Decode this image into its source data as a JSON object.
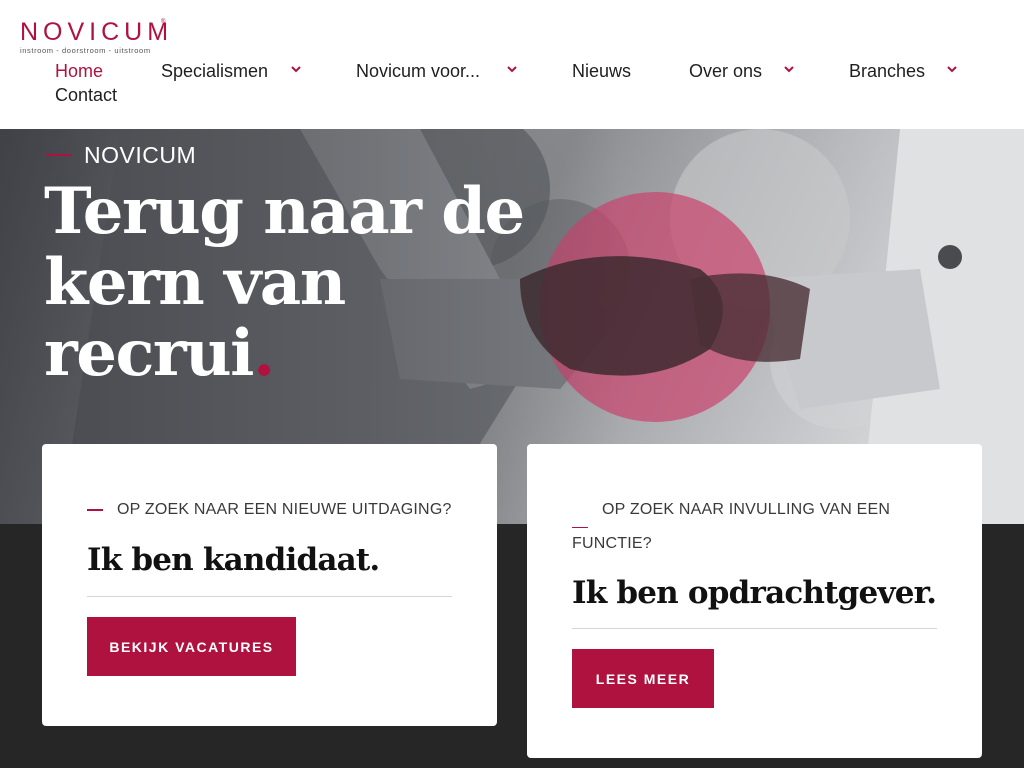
{
  "brand": {
    "name": "NOVICUM",
    "registered_mark": "®",
    "tagline": "instroom - doorstroom - uitstroom",
    "accent_color": "#b0123f"
  },
  "nav": {
    "items": [
      {
        "label": "Home",
        "active": true,
        "has_dropdown": false
      },
      {
        "label": "Specialismen",
        "active": false,
        "has_dropdown": true
      },
      {
        "label": "Novicum voor...",
        "active": false,
        "has_dropdown": true
      },
      {
        "label": "Nieuws",
        "active": false,
        "has_dropdown": false
      },
      {
        "label": "Over ons",
        "active": false,
        "has_dropdown": true
      },
      {
        "label": "Branches",
        "active": false,
        "has_dropdown": true
      },
      {
        "label": "Contact",
        "active": false,
        "has_dropdown": false
      }
    ],
    "dropdown_icon": "chevron-down-icon"
  },
  "hero": {
    "eyebrow": "NOVICUM",
    "title_lines": [
      "Terug naar de",
      "kern van",
      "recrui"
    ],
    "title_dot": ".",
    "image": "handshake-photo"
  },
  "cards": [
    {
      "eyebrow": "OP ZOEK NAAR EEN NIEUWE UITDAGING?",
      "title": "Ik ben kandidaat.",
      "button": "BEKIJK VACATURES"
    },
    {
      "eyebrow": "OP ZOEK NAAR INVULLING VAN EEN FUNCTIE?",
      "title": "Ik ben opdrachtgever.",
      "button": "LEES MEER"
    }
  ]
}
